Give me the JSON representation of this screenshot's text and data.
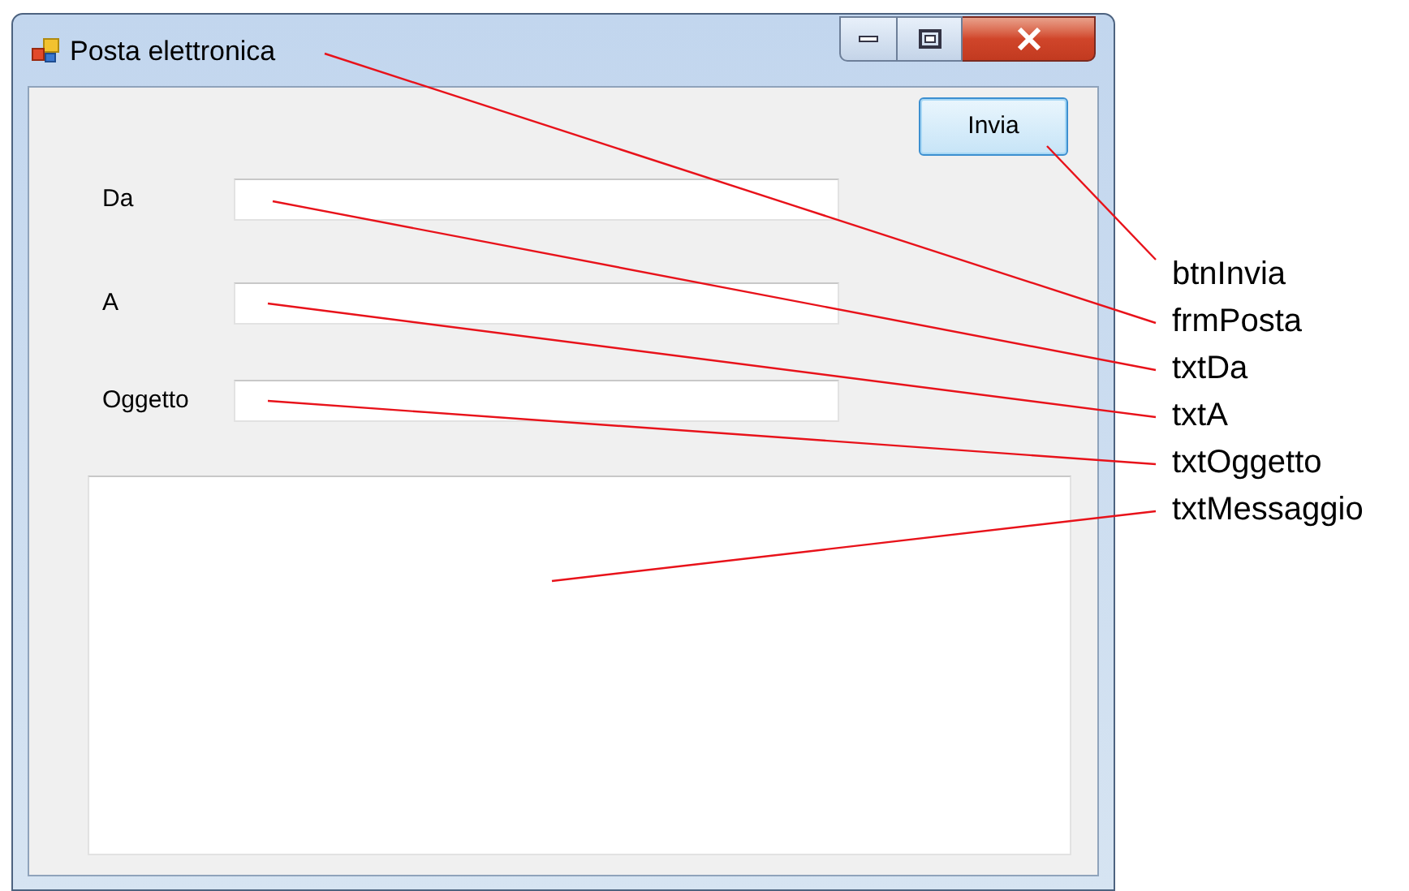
{
  "window": {
    "title": "Posta elettronica"
  },
  "send_button": {
    "label": "Invia"
  },
  "fields": [
    {
      "label": "Da"
    },
    {
      "label": "A"
    },
    {
      "label": "Oggetto"
    }
  ],
  "message_box": {
    "kind": "textarea"
  },
  "annotations": [
    {
      "label": "btnInvia"
    },
    {
      "label": "frmPosta"
    },
    {
      "label": "txtDa"
    },
    {
      "label": "txtA"
    },
    {
      "label": "txtOggetto"
    },
    {
      "label": "txtMessaggio"
    }
  ]
}
